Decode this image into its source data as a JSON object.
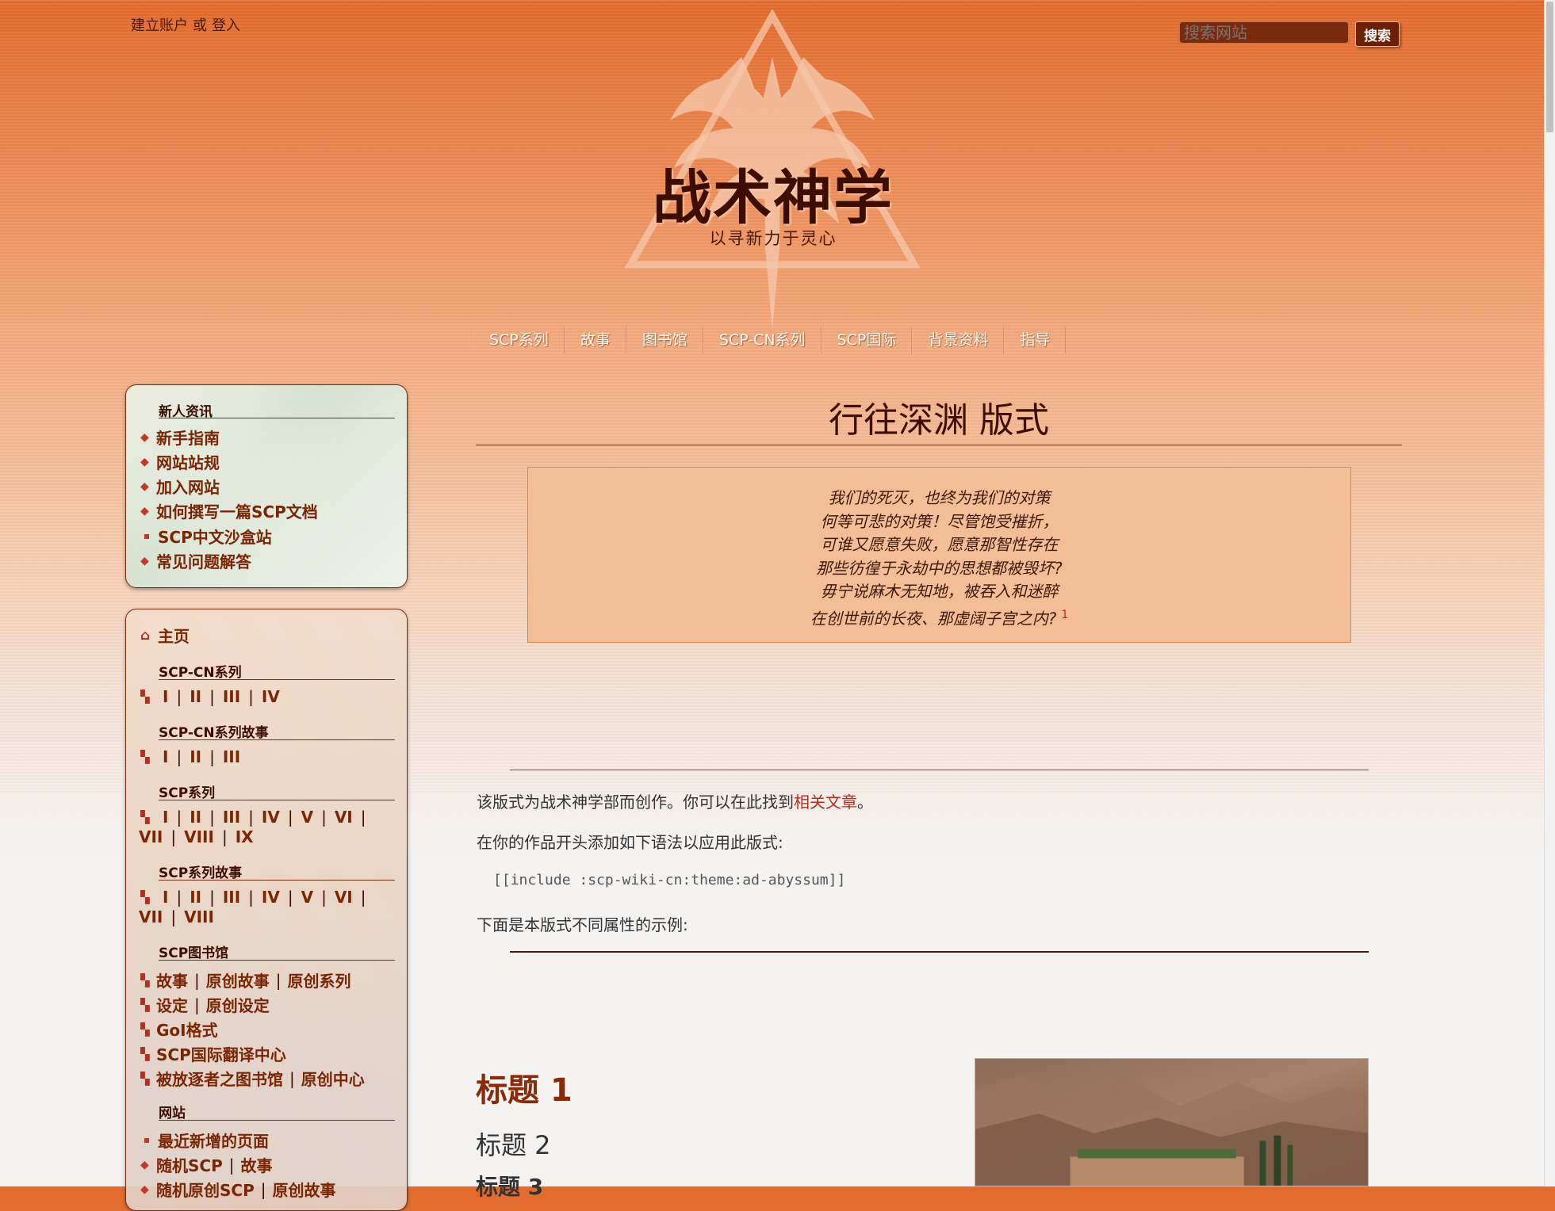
{
  "header": {
    "create_account": "建立账户",
    "or": "或",
    "login": "登入",
    "search_placeholder": "搜索网站",
    "search_button": "搜索",
    "site_title": "战术神学",
    "site_subtitle": "以寻新力于灵心"
  },
  "topnav": [
    "SCP系列",
    "故事",
    "图书馆",
    "SCP-CN系列",
    "SCP国际",
    "背景资料",
    "指导"
  ],
  "sidebar_top": {
    "heading": "新人资讯",
    "items": [
      "新手指南",
      "网站站规",
      "加入网站",
      "如何撰写一篇SCP文档",
      "SCP中文沙盒站",
      "常见问题解答"
    ]
  },
  "sidebar_main": {
    "home": "主页",
    "scp_cn_series": {
      "heading": "SCP-CN系列",
      "items": [
        "I",
        "II",
        "III",
        "IV"
      ]
    },
    "scp_cn_tales": {
      "heading": "SCP-CN系列故事",
      "items": [
        "I",
        "II",
        "III"
      ]
    },
    "scp_series": {
      "heading": "SCP系列",
      "row1": [
        "I",
        "II",
        "III",
        "IV",
        "V",
        "VI"
      ],
      "row2": [
        "VII",
        "VIII",
        "IX"
      ]
    },
    "scp_tales": {
      "heading": "SCP系列故事",
      "row1": [
        "I",
        "II",
        "III",
        "IV",
        "V",
        "VI"
      ],
      "row2": [
        "VII",
        "VIII"
      ]
    },
    "library": {
      "heading": "SCP图书馆",
      "row1": [
        "故事",
        "原创故事",
        "原创系列"
      ],
      "row2": [
        "设定",
        "原创设定"
      ],
      "row3": [
        "GoI格式"
      ],
      "row4": [
        "SCP国际翻译中心"
      ],
      "row5": [
        "被放逐者之图书馆",
        "原创中心"
      ]
    },
    "site": {
      "heading": "网站",
      "row1": [
        "最近新增的页面"
      ],
      "row2": [
        "随机SCP",
        "故事"
      ],
      "row3": [
        "随机原创SCP",
        "原创故事"
      ]
    },
    "separator": "|"
  },
  "main": {
    "page_title": "行往深渊 版式",
    "quote_lines": [
      "我们的死灭，也终为我们的对策",
      "何等可悲的对策！尽管饱受摧折，",
      "可谁又愿意失败，愿意那智性存在",
      "那些彷徨于永劫中的思想都被毁坏?",
      "毋宁说麻木无知地，被吞入和迷醉",
      "在创世前的长夜、那虚阔子宫之内?"
    ],
    "quote_footnote": "1",
    "para1_before": "该版式为战术神学部而创作。你可以在此找到",
    "para1_link": "相关文章",
    "para1_after": "。",
    "para2": "在你的作品开头添加如下语法以应用此版式:",
    "code": "[[include :scp-wiki-cn:theme:ad-abyssum]]",
    "para3": "下面是本版式不同属性的示例:",
    "h1": "标题 1",
    "h2": "标题 2",
    "h3": "标题 3"
  },
  "colors": {
    "accent": "#7a2605",
    "link": "#b13020",
    "title_dark": "#3d0e00",
    "quote_bg": "#f3bd98"
  }
}
